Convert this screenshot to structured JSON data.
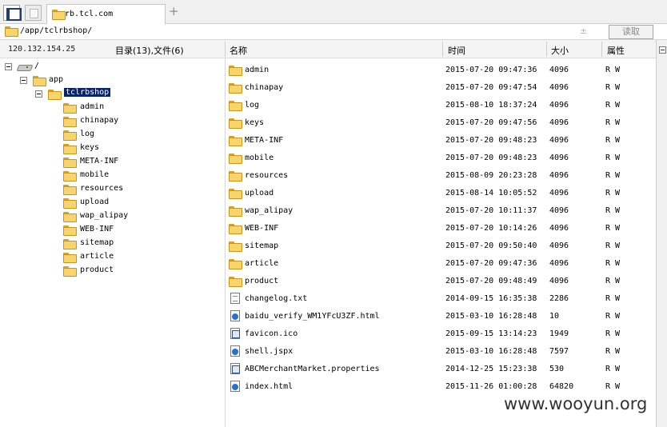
{
  "tab": {
    "title": "rb.tcl.com",
    "add_label": "+"
  },
  "address": {
    "path": "/app/tclrbshop/",
    "up_icon": "±",
    "read_label": "读取"
  },
  "info": {
    "ip": "120.132.154.25",
    "counts": "目录(13),文件(6)"
  },
  "columns": {
    "name": "名称",
    "time": "时间",
    "size": "大小",
    "attr": "属性"
  },
  "tree": {
    "root": "/",
    "app": "app",
    "selected": "tclrbshop",
    "children": [
      "admin",
      "chinapay",
      "log",
      "keys",
      "META-INF",
      "mobile",
      "resources",
      "upload",
      "wap_alipay",
      "WEB-INF",
      "sitemap",
      "article",
      "product"
    ]
  },
  "files": [
    {
      "icon": "folder-icon",
      "name": "admin",
      "time": "2015-07-20 09:47:36",
      "size": "4096",
      "attr": "R W"
    },
    {
      "icon": "folder-icon",
      "name": "chinapay",
      "time": "2015-07-20 09:47:54",
      "size": "4096",
      "attr": "R W"
    },
    {
      "icon": "folder-icon",
      "name": "log",
      "time": "2015-08-10 18:37:24",
      "size": "4096",
      "attr": "R W"
    },
    {
      "icon": "folder-icon",
      "name": "keys",
      "time": "2015-07-20 09:47:56",
      "size": "4096",
      "attr": "R W"
    },
    {
      "icon": "folder-icon",
      "name": "META-INF",
      "time": "2015-07-20 09:48:23",
      "size": "4096",
      "attr": "R W"
    },
    {
      "icon": "folder-icon",
      "name": "mobile",
      "time": "2015-07-20 09:48:23",
      "size": "4096",
      "attr": "R W"
    },
    {
      "icon": "folder-icon",
      "name": "resources",
      "time": "2015-08-09 20:23:28",
      "size": "4096",
      "attr": "R W"
    },
    {
      "icon": "folder-icon",
      "name": "upload",
      "time": "2015-08-14 10:05:52",
      "size": "4096",
      "attr": "R W"
    },
    {
      "icon": "folder-icon",
      "name": "wap_alipay",
      "time": "2015-07-20 10:11:37",
      "size": "4096",
      "attr": "R W"
    },
    {
      "icon": "folder-icon",
      "name": "WEB-INF",
      "time": "2015-07-20 10:14:26",
      "size": "4096",
      "attr": "R W"
    },
    {
      "icon": "folder-icon",
      "name": "sitemap",
      "time": "2015-07-20 09:50:40",
      "size": "4096",
      "attr": "R W"
    },
    {
      "icon": "folder-icon",
      "name": "article",
      "time": "2015-07-20 09:47:36",
      "size": "4096",
      "attr": "R W"
    },
    {
      "icon": "folder-icon",
      "name": "product",
      "time": "2015-07-20 09:48:49",
      "size": "4096",
      "attr": "R W"
    },
    {
      "icon": "text-file-icon",
      "name": "changelog.txt",
      "time": "2014-09-15 16:35:38",
      "size": "2286",
      "attr": "R W"
    },
    {
      "icon": "html-file-icon",
      "name": "baidu_verify_WM1YFcU3ZF.html",
      "time": "2015-03-10 16:28:48",
      "size": "10",
      "attr": "R W"
    },
    {
      "icon": "ico-file-icon",
      "name": "favicon.ico",
      "time": "2015-09-15 13:14:23",
      "size": "1949",
      "attr": "R W"
    },
    {
      "icon": "jspx-file-icon",
      "name": "shell.jspx",
      "time": "2015-03-10 16:28:48",
      "size": "7597",
      "attr": "R W"
    },
    {
      "icon": "properties-file-icon",
      "name": "ABCMerchantMarket.properties",
      "time": "2014-12-25 15:23:38",
      "size": "530",
      "attr": "R W"
    },
    {
      "icon": "html-file-icon",
      "name": "index.html",
      "time": "2015-11-26 01:00:28",
      "size": "64820",
      "attr": "R W"
    }
  ],
  "watermark": "www.wooyun.org"
}
